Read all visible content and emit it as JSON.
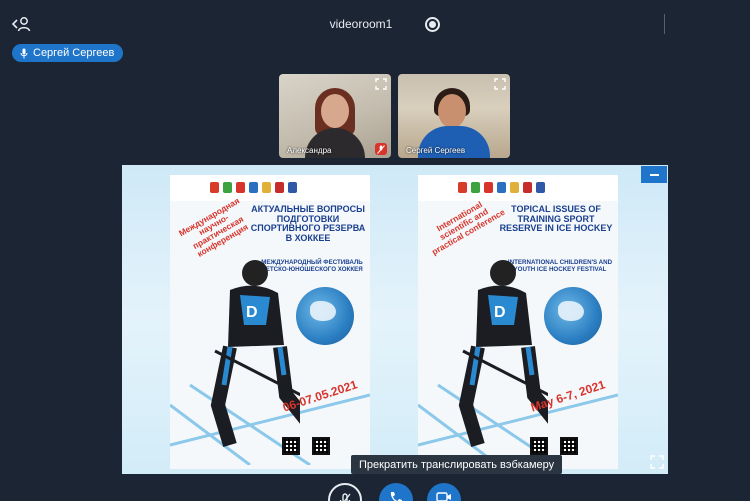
{
  "header": {
    "room_name": "videoroom1"
  },
  "self": {
    "name": "Сергей Сергеев"
  },
  "participants": [
    {
      "name": "Александра",
      "muted": true
    },
    {
      "name": "Сергей Сергеев",
      "muted": false
    }
  ],
  "shared_screen": {
    "poster_ru": {
      "ribbon": "Международная научно-практическая конференция",
      "title": "Актуальные вопросы подготовки спортивного резерва в хоккее",
      "subtitle": "Международный фестиваль детско-юношеского хоккея",
      "date": "06-07.05.2021"
    },
    "poster_en": {
      "ribbon": "International scientific and practical conference",
      "title": "Topical issues of training sport reserve in ice hockey",
      "subtitle": "International children's and youth ice hockey festival",
      "date": "May 6-7, 2021"
    }
  },
  "controls": {
    "tooltip": "Прекратить транслировать вэбкамеру"
  },
  "colors": {
    "background": "#1b2533",
    "accent": "#1e75c9",
    "danger": "#d9342b"
  }
}
